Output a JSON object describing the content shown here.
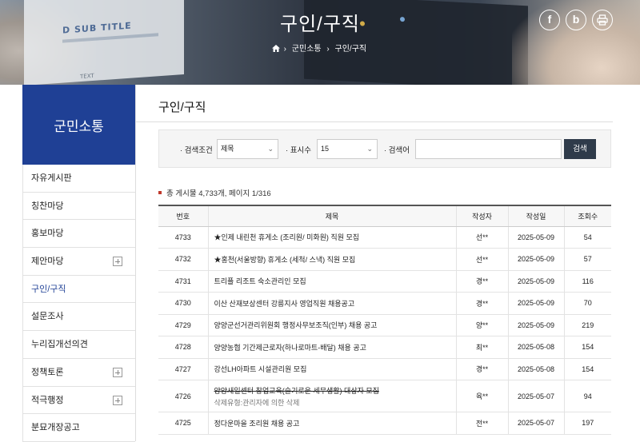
{
  "header": {
    "title": "구인/구직",
    "breadcrumb": [
      "군민소통",
      "구인/구직"
    ],
    "banner_screen_title": "D SUB TITLE",
    "banner_screen_text": "TEXT",
    "share": {
      "facebook": "f",
      "blog": "b"
    }
  },
  "sidebar": {
    "heading": "군민소통",
    "items": [
      {
        "label": "자유게시판",
        "expandable": false,
        "active": false
      },
      {
        "label": "칭찬마당",
        "expandable": false,
        "active": false
      },
      {
        "label": "홍보마당",
        "expandable": false,
        "active": false
      },
      {
        "label": "제안마당",
        "expandable": true,
        "active": false
      },
      {
        "label": "구인/구직",
        "expandable": false,
        "active": true
      },
      {
        "label": "설문조사",
        "expandable": false,
        "active": false
      },
      {
        "label": "누리집개선의견",
        "expandable": false,
        "active": false
      },
      {
        "label": "정책토론",
        "expandable": true,
        "active": false
      },
      {
        "label": "적극행정",
        "expandable": true,
        "active": false
      },
      {
        "label": "분묘개장공고",
        "expandable": false,
        "active": false
      }
    ]
  },
  "main": {
    "title": "구인/구직",
    "search": {
      "condition_label": "· 검색조건",
      "condition_value": "제목",
      "count_label": "· 표시수",
      "count_value": "15",
      "keyword_label": "· 검색어",
      "keyword_value": "",
      "button": "검색"
    },
    "summary": "총 게시물 4,733개, 페이지 1/316",
    "table": {
      "headers": [
        "번호",
        "제목",
        "작성자",
        "작성일",
        "조회수"
      ],
      "rows": [
        {
          "no": "4733",
          "title": "★인제 내린천 휴게소 (조리원/ 미화원) 직원 모집",
          "writer": "선**",
          "date": "2025-05-09",
          "views": "54"
        },
        {
          "no": "4732",
          "title": "★홍천(서울방향) 휴게소 (세척/ 스낵) 직원 모집",
          "writer": "선**",
          "date": "2025-05-09",
          "views": "57"
        },
        {
          "no": "4731",
          "title": "트리플 리조트 숙소관리인 모집",
          "writer": "경**",
          "date": "2025-05-09",
          "views": "116"
        },
        {
          "no": "4730",
          "title": "이산 산재보상센터 강릉지사 영업직원 채용공고",
          "writer": "경**",
          "date": "2025-05-09",
          "views": "70"
        },
        {
          "no": "4729",
          "title": "양양군선거관리위원회 행정사무보조직(인부) 채용 공고",
          "writer": "양**",
          "date": "2025-05-09",
          "views": "219"
        },
        {
          "no": "4728",
          "title": "양양농협 기간제근로자(하나로마트-배달) 채용 공고",
          "writer": "최**",
          "date": "2025-05-08",
          "views": "154"
        },
        {
          "no": "4727",
          "title": "강선LH아파트 시설관리원 모집",
          "writer": "경**",
          "date": "2025-05-08",
          "views": "154"
        },
        {
          "no": "4726",
          "title": "양양새일센터 창업교육(슬기로운 세무생활) 대상자 모집",
          "note": "삭제유형:관리자에 의한 삭제",
          "writer": "육**",
          "date": "2025-05-07",
          "views": "94"
        },
        {
          "no": "4725",
          "title": "정다운마을 조리원 채용 공고",
          "writer": "전**",
          "date": "2025-05-07",
          "views": "197"
        }
      ]
    }
  }
}
